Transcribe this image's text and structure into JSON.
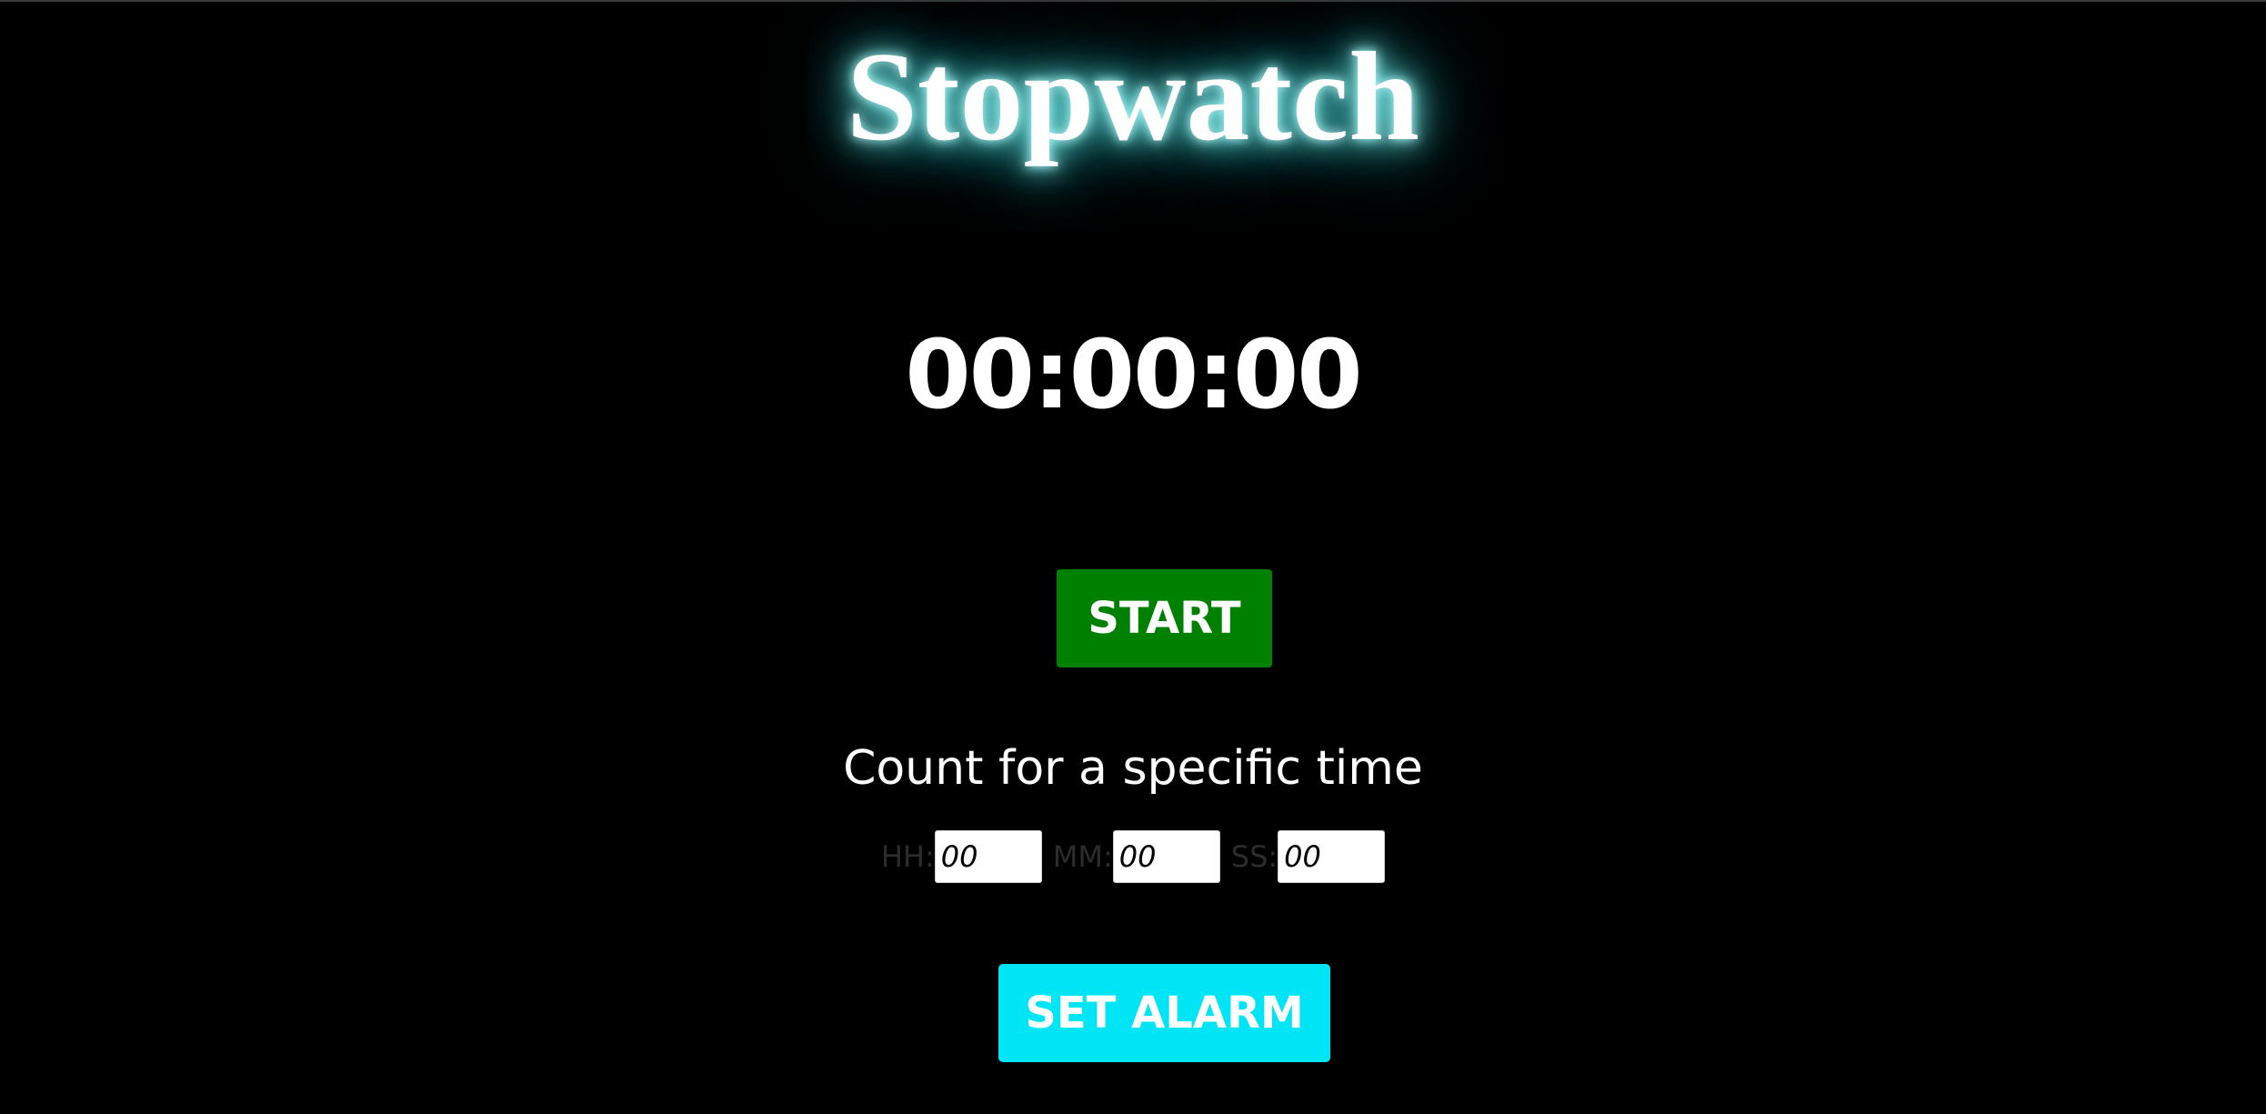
{
  "header": {
    "title": "Stopwatch"
  },
  "timer": {
    "display": "00:00:00"
  },
  "controls": {
    "start_label": "START",
    "set_alarm_label": "SET ALARM"
  },
  "countdown": {
    "heading": "Count for a specific time",
    "hours_label": "HH:",
    "hours_placeholder": "00",
    "minutes_label": "MM:",
    "minutes_placeholder": "00",
    "seconds_label": "SS:",
    "seconds_placeholder": "00"
  },
  "colors": {
    "background": "#000000",
    "title_glow": "#7ff3f0",
    "start_button": "#008000",
    "set_alarm_button": "#00e5f5",
    "input_label": "#2c2c2c"
  }
}
